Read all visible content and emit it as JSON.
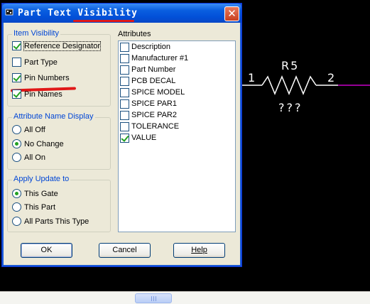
{
  "window": {
    "title": "Part Text Visibility",
    "close_glyph": "✕"
  },
  "item_visibility": {
    "label": "Item Visibility",
    "items": [
      {
        "label": "Reference Designator",
        "checked": true
      },
      {
        "label": "Part Type",
        "checked": false
      },
      {
        "label": "Pin Numbers",
        "checked": true
      },
      {
        "label": "Pin Names",
        "checked": true
      }
    ]
  },
  "attribute_name_display": {
    "label": "Attribute Name Display",
    "options": [
      {
        "label": "All Off",
        "selected": false
      },
      {
        "label": "No Change",
        "selected": true
      },
      {
        "label": "All On",
        "selected": false
      }
    ]
  },
  "apply_update_to": {
    "label": "Apply Update to",
    "options": [
      {
        "label": "This Gate",
        "selected": true
      },
      {
        "label": "This Part",
        "selected": false
      },
      {
        "label": "All Parts This Type",
        "selected": false
      }
    ]
  },
  "attributes": {
    "label": "Attributes",
    "items": [
      {
        "label": "Description",
        "checked": false
      },
      {
        "label": "Manufacturer #1",
        "checked": false
      },
      {
        "label": "Part Number",
        "checked": false
      },
      {
        "label": "PCB DECAL",
        "checked": false
      },
      {
        "label": "SPICE MODEL",
        "checked": false
      },
      {
        "label": "SPICE PAR1",
        "checked": false
      },
      {
        "label": "SPICE PAR2",
        "checked": false
      },
      {
        "label": "TOLERANCE",
        "checked": false
      },
      {
        "label": "VALUE",
        "checked": true
      }
    ]
  },
  "buttons": {
    "ok": "OK",
    "cancel": "Cancel",
    "help": "Help"
  },
  "schematic": {
    "ref": "R5",
    "pin1": "1",
    "pin2": "2",
    "value": "???"
  },
  "colors": {
    "annotation_red": "#E01818",
    "check_green": "#21A121",
    "group_label_blue": "#0046D5",
    "wire_magenta": "#C800C8"
  }
}
